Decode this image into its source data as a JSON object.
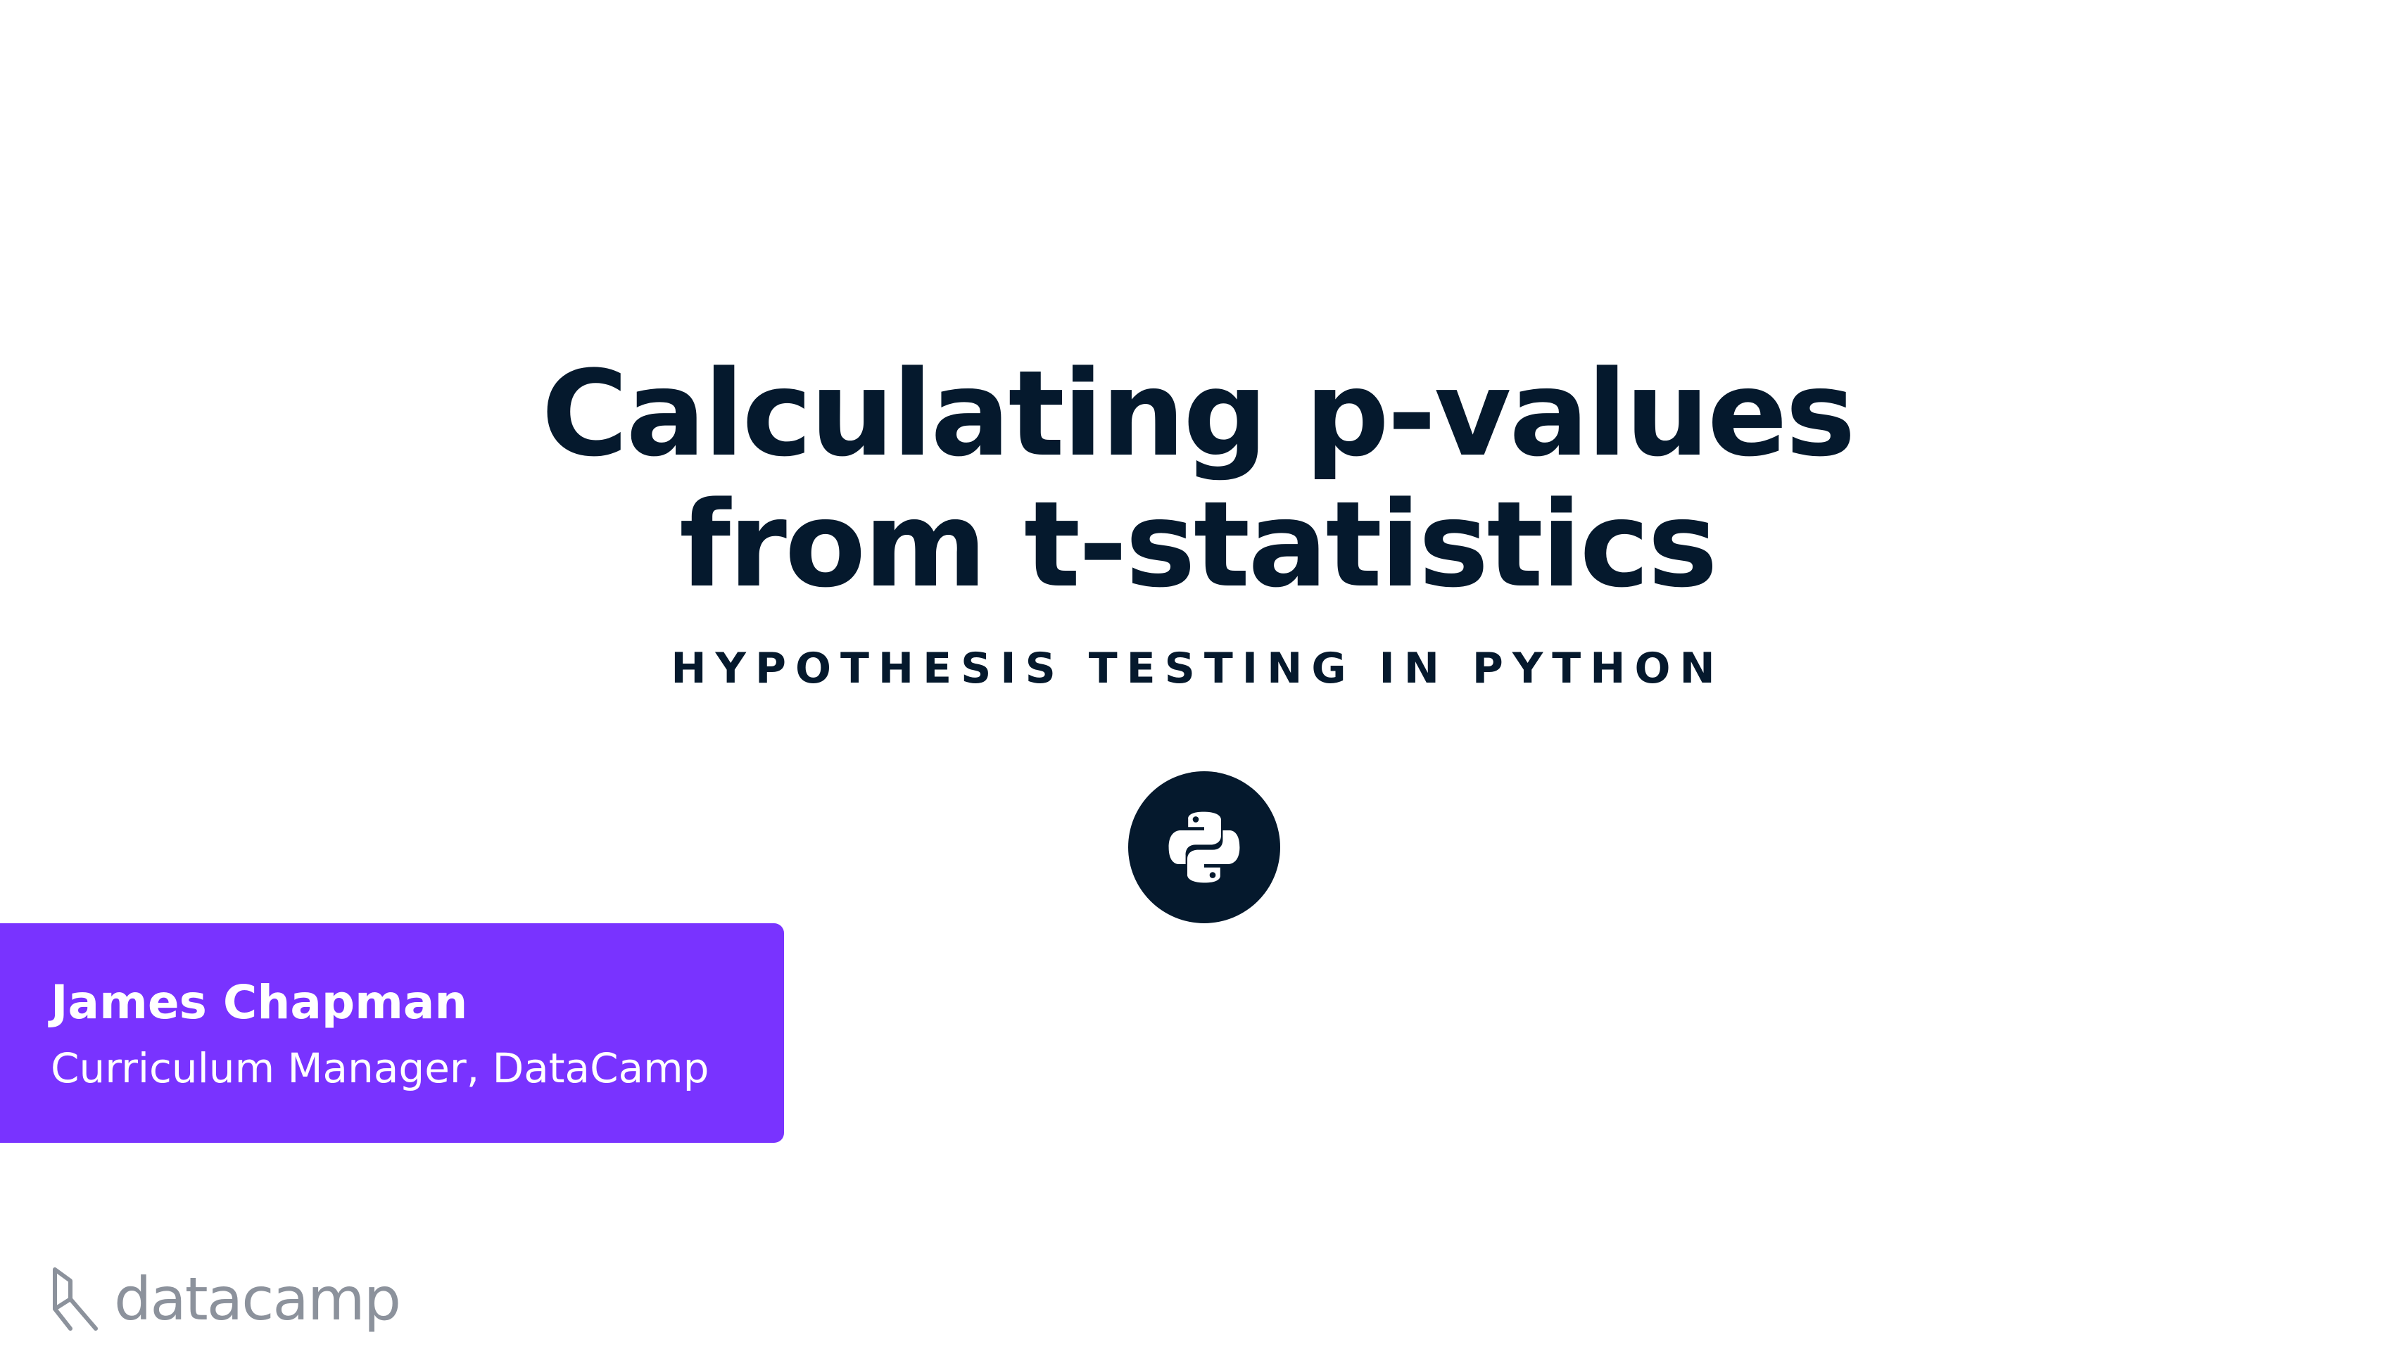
{
  "slide": {
    "title_lines": [
      "Calculating p-values",
      "from t-statistics"
    ],
    "subtitle": "HYPOTHESIS TESTING IN PYTHON",
    "course_icon": "python-logo-icon"
  },
  "author": {
    "name": "James Chapman",
    "role": "Curriculum Manager, DataCamp"
  },
  "brand": {
    "logo_icon": "datacamp-logo-icon",
    "name": "datacamp"
  },
  "colors": {
    "title": "#05192d",
    "accent": "#7933ff",
    "brand_gray": "#8c929c",
    "background": "#ffffff"
  }
}
